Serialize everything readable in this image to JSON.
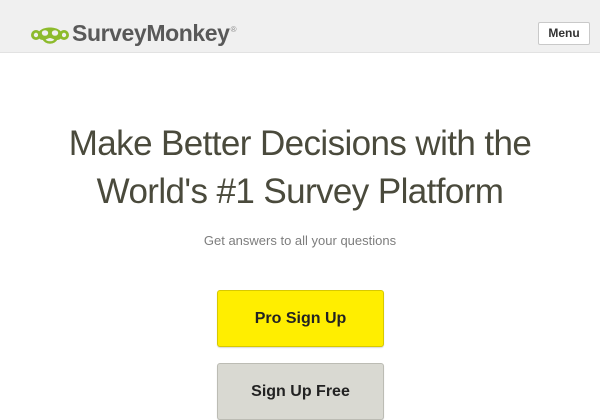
{
  "header": {
    "brand_name": "SurveyMonkey",
    "brand_registered_mark": "®",
    "menu_label": "Menu",
    "brand_color": "#8dbb2c"
  },
  "hero": {
    "title_line1": "Make Better Decisions with the",
    "title_line2": "World's #1 Survey Platform",
    "subtitle": "Get answers to all your questions"
  },
  "cta": {
    "primary_label": "Pro Sign Up",
    "primary_color": "#ffee00",
    "secondary_label": "Sign Up Free",
    "secondary_color": "#d9d9d2"
  },
  "icons": {
    "logo": "surveymonkey-logo-icon"
  }
}
